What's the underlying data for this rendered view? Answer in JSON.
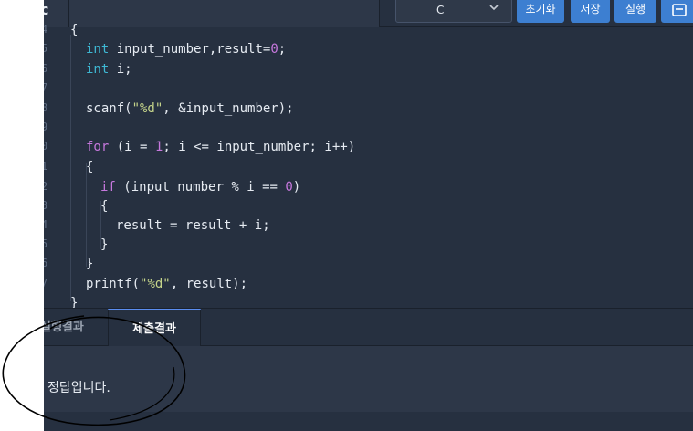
{
  "toolbar": {
    "file_tab_label": "c",
    "language_selected": "C",
    "reset_label": "초기화",
    "save_label": "저장",
    "run_label": "실행"
  },
  "editor": {
    "line_numbers": [
      "4",
      "5",
      "6",
      "7",
      "8",
      "9",
      "0",
      "1",
      "2",
      "3",
      "4",
      "5",
      "6",
      "7"
    ],
    "lines": [
      "{",
      "int input_number,result=0;",
      "int i;",
      "",
      "scanf(\"%d\", &input_number);",
      "",
      "for (i = 1; i <= input_number; i++)",
      "{",
      "if (input_number % i == 0)",
      "{",
      "result = result + i;",
      "}",
      "}",
      "printf(\"%d\", result);",
      "}"
    ]
  },
  "results": {
    "tabs": [
      "실행결과",
      "제출결과"
    ],
    "active_tab": "제출결과",
    "message": "정답입니다."
  },
  "colors": {
    "background": "#263040",
    "accent": "#3d7fd1",
    "keyword": "#3eb8d4",
    "number": "#c678dd",
    "string": "#c5d48a"
  }
}
